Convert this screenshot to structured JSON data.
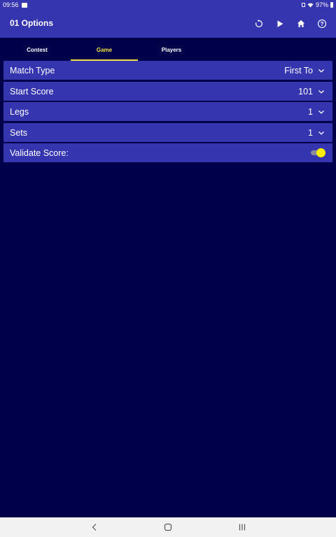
{
  "status_bar": {
    "time": "09:56",
    "battery": "97%"
  },
  "app_bar": {
    "title": "01 Options",
    "actions": [
      "reset-icon",
      "play-icon",
      "home-icon",
      "help-icon"
    ]
  },
  "tabs": [
    {
      "label": "Contest",
      "active": false
    },
    {
      "label": "Game",
      "active": true
    },
    {
      "label": "Players",
      "active": false
    }
  ],
  "settings": {
    "match_type": {
      "label": "Match Type",
      "value": "First To"
    },
    "start_score": {
      "label": "Start Score",
      "value": "101"
    },
    "legs": {
      "label": "Legs",
      "value": "1"
    },
    "sets": {
      "label": "Sets",
      "value": "1"
    },
    "validate_score": {
      "label": "Validate Score:",
      "enabled": true
    }
  },
  "colors": {
    "background": "#00004a",
    "bar": "#3535b0",
    "accent": "#f0e040",
    "toggle_on": "#ffee00"
  }
}
